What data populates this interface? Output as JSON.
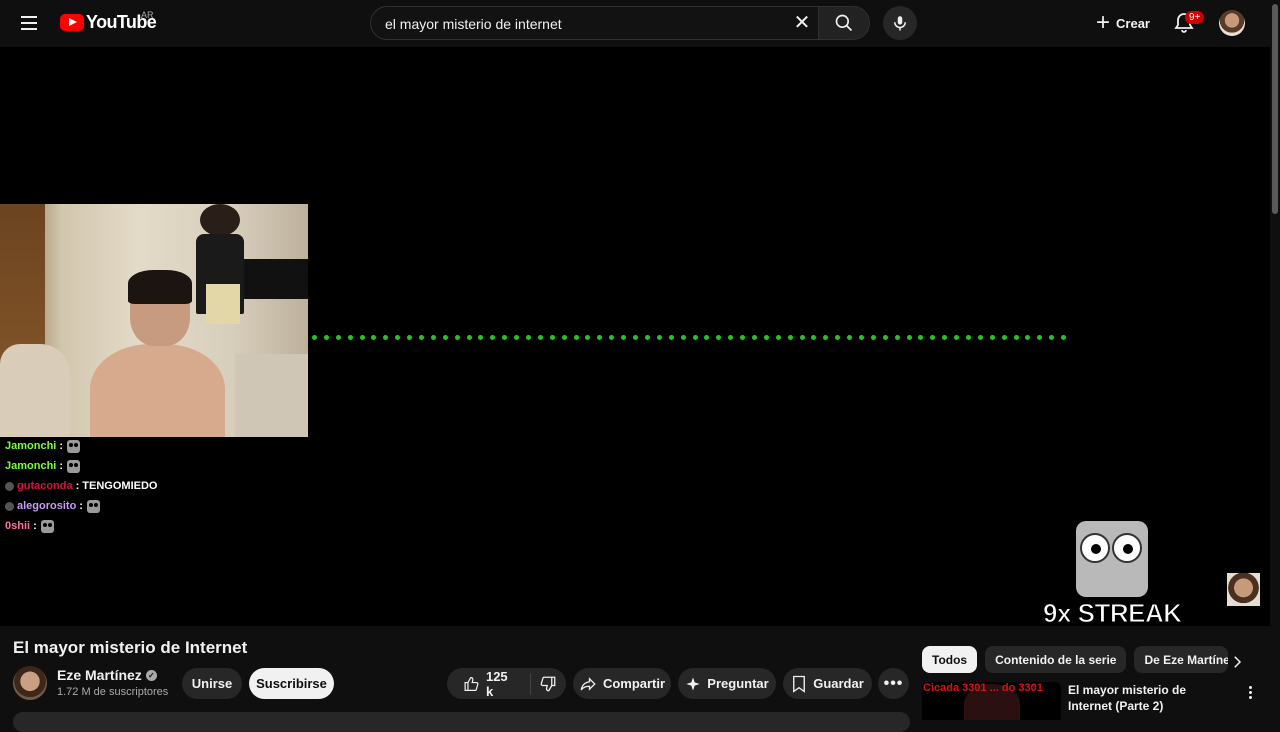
{
  "header": {
    "logo_text": "YouTube",
    "region": "AR",
    "search_value": "el mayor misterio de internet",
    "create_label": "Crear",
    "notifications_badge": "9+"
  },
  "player": {
    "chat": [
      {
        "user": "Jamonchi",
        "color": "#7CFC3A",
        "message": "",
        "has_badge": false,
        "emote": true
      },
      {
        "user": "Jamonchi",
        "color": "#7CFC3A",
        "message": "",
        "has_badge": false,
        "emote": true
      },
      {
        "user": "gutaconda",
        "color": "#d4143c",
        "message": "TENGOMIEDO",
        "has_badge": true,
        "emote": false
      },
      {
        "user": "alegorosito",
        "color": "#c79cf4",
        "message": "",
        "has_badge": true,
        "emote": true
      },
      {
        "user": "0shii",
        "color": "#ff6fa1",
        "message": "",
        "has_badge": false,
        "emote": true
      }
    ],
    "streak_text": "9x STREAK",
    "dot_color": "#27c427"
  },
  "video": {
    "title": "El mayor misterio de Internet",
    "channel_name": "Eze Martínez",
    "subscribers": "1.72 M de suscriptores",
    "join_label": "Unirse",
    "subscribe_label": "Suscribirse",
    "likes": "125 k",
    "share_label": "Compartir",
    "ask_label": "Preguntar",
    "save_label": "Guardar"
  },
  "sidebar": {
    "chips": [
      "Todos",
      "Contenido de la serie",
      "De Eze Martínez"
    ],
    "recommendation": {
      "thumb_text": "Cicada 3301 ... do 3301",
      "title": "El mayor misterio de Internet (Parte 2)"
    }
  }
}
